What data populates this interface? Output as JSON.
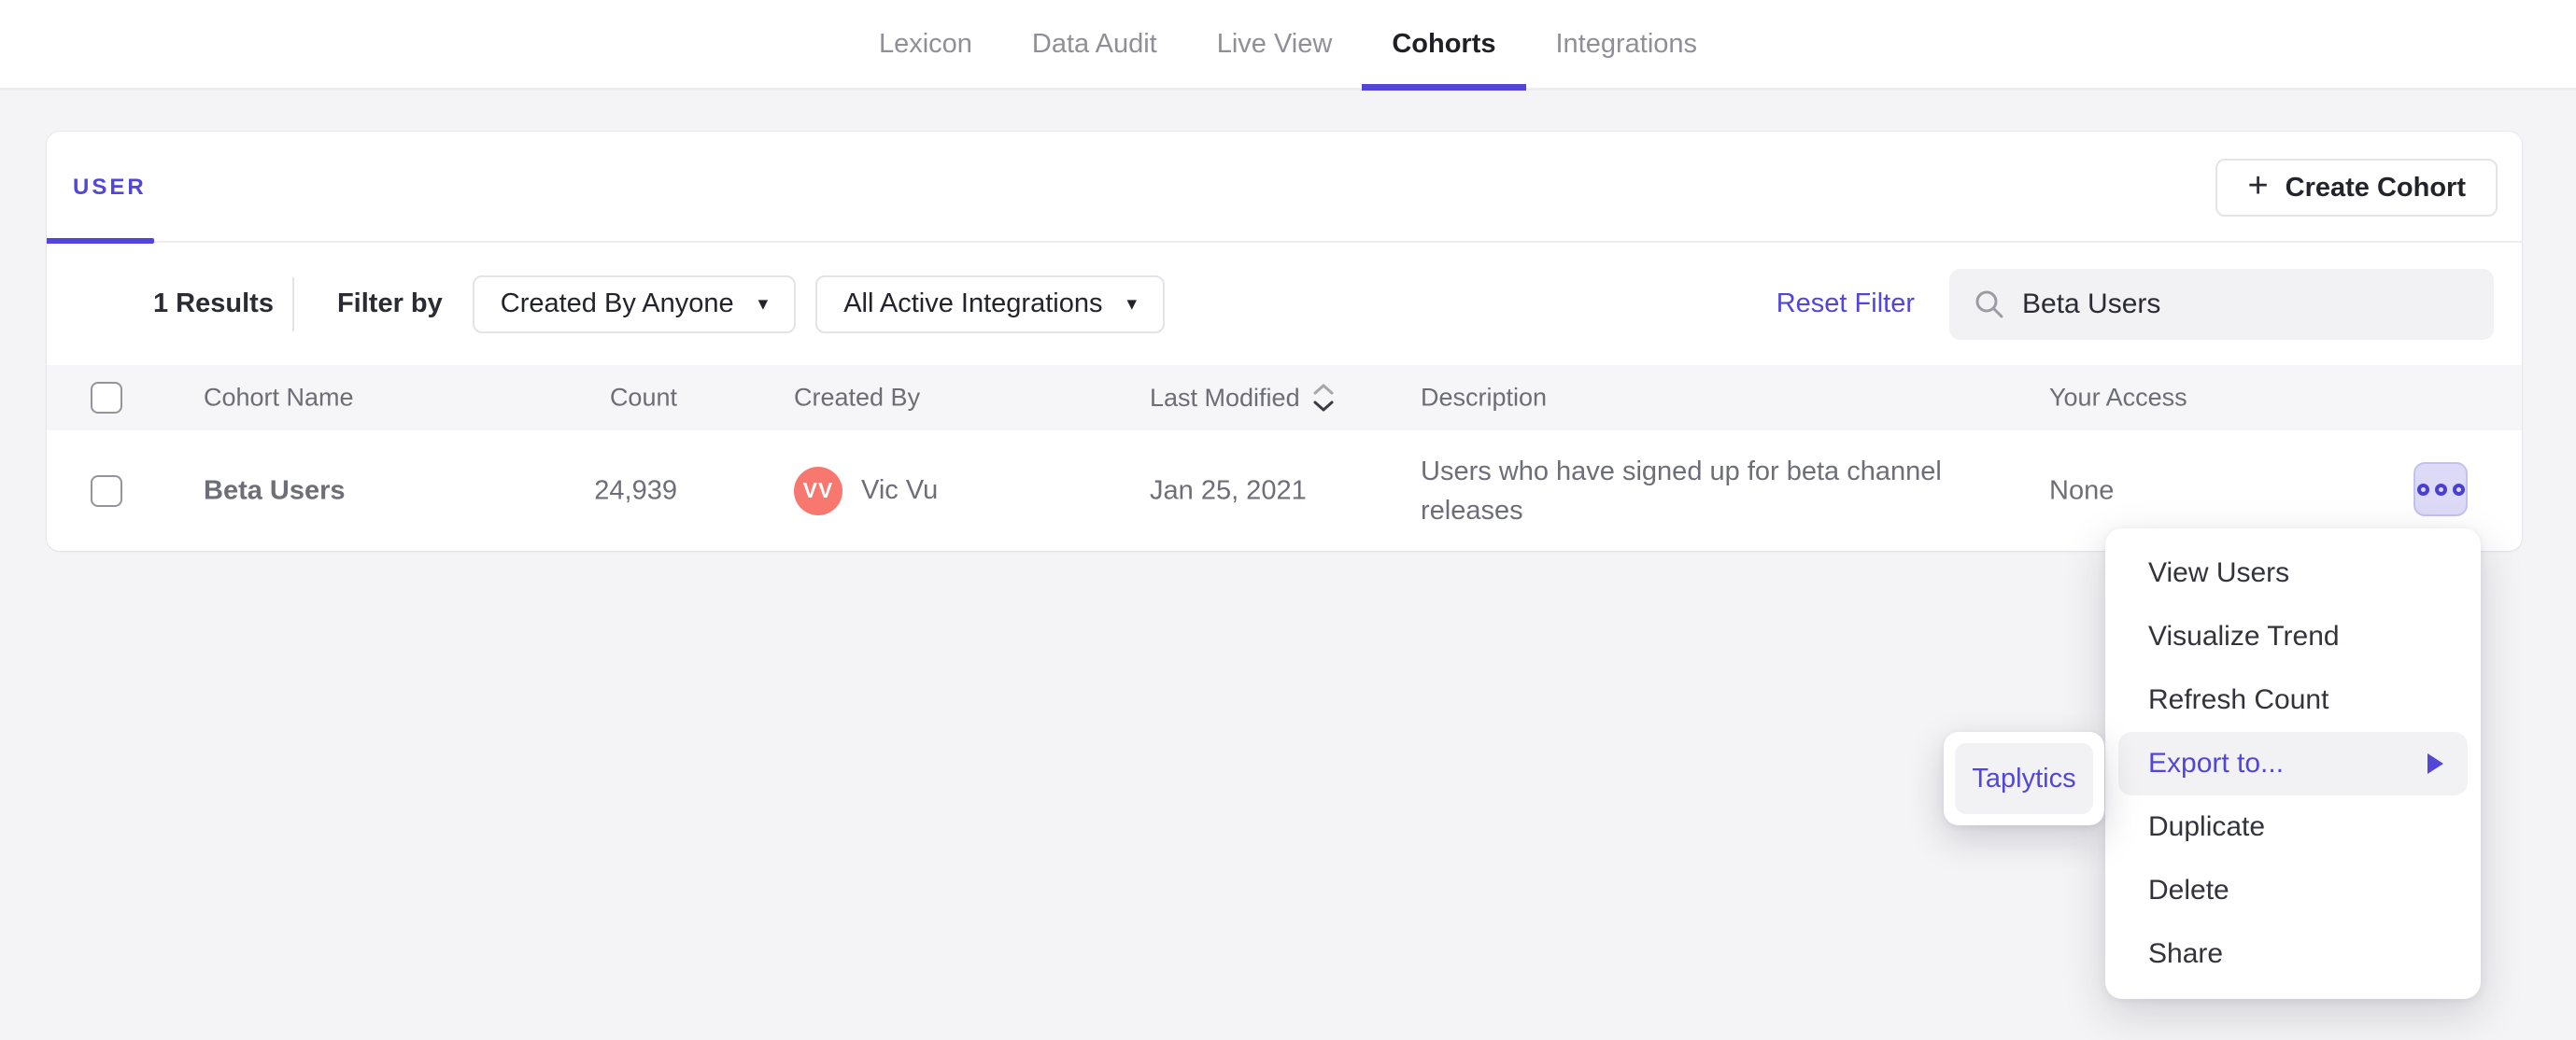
{
  "nav": {
    "tabs": [
      {
        "label": "Lexicon"
      },
      {
        "label": "Data Audit"
      },
      {
        "label": "Live View"
      },
      {
        "label": "Cohorts"
      },
      {
        "label": "Integrations"
      }
    ],
    "active_tab": "Cohorts"
  },
  "panel": {
    "type_tab": "USER",
    "create_cohort_button": "Create Cohort",
    "filter_bar": {
      "results": "1 Results",
      "filter_by": "Filter by",
      "created_by_filter": "Created By Anyone",
      "integrations_filter": "All Active Integrations",
      "reset_filter": "Reset Filter",
      "search_value": "Beta Users"
    },
    "table": {
      "headers": {
        "name": "Cohort Name",
        "count": "Count",
        "created_by": "Created By",
        "last_modified": "Last Modified",
        "description": "Description",
        "access": "Your Access"
      },
      "rows": [
        {
          "name": "Beta Users",
          "count": "24,939",
          "creator_initials": "VV",
          "creator_name": "Vic Vu",
          "last_modified": "Jan 25, 2021",
          "description": "Users who have signed up for beta channel releases",
          "access": "None"
        }
      ]
    }
  },
  "context_menu": {
    "items": [
      "View Users",
      "Visualize Trend",
      "Refresh Count",
      "Export to...",
      "Duplicate",
      "Delete",
      "Share"
    ],
    "highlighted_item": "Export to...",
    "submenu_items": [
      "Taplytics"
    ]
  },
  "icons": {
    "plus": "+",
    "caret_down": "▾",
    "search": "magnifier-icon",
    "sort": "sort-chevrons-icon",
    "more": "three-rings-icon",
    "submenu_arrow": "right-triangle-icon"
  },
  "colors": {
    "accent": "#5246d9",
    "avatar": "#f8776f",
    "highlight_bg": "#f2f2f4",
    "more_button_bg": "#dcdaf7",
    "page_bg": "#f4f4f6"
  }
}
